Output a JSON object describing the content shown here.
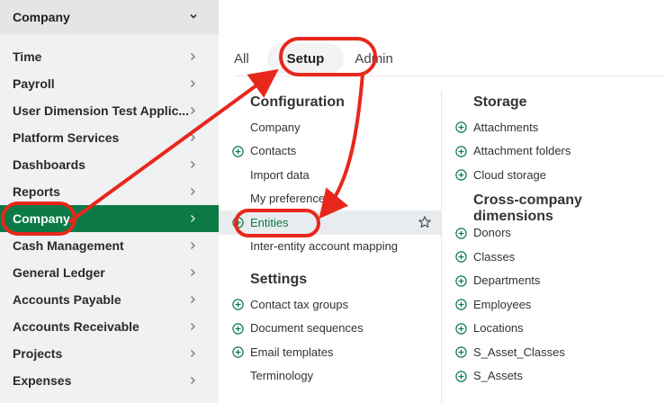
{
  "sidebar": {
    "header_label": "Company",
    "items": [
      {
        "label": "Time"
      },
      {
        "label": "Payroll"
      },
      {
        "label": "User Dimension Test Applic..."
      },
      {
        "label": "Platform Services"
      },
      {
        "label": "Dashboards"
      },
      {
        "label": "Reports"
      },
      {
        "label": "Company",
        "active": true
      },
      {
        "label": "Cash Management"
      },
      {
        "label": "General Ledger"
      },
      {
        "label": "Accounts Payable"
      },
      {
        "label": "Accounts Receivable"
      },
      {
        "label": "Projects"
      },
      {
        "label": "Expenses"
      }
    ]
  },
  "tabs": [
    {
      "label": "All"
    },
    {
      "label": "Setup",
      "active": true
    },
    {
      "label": "Admin"
    }
  ],
  "configuration": {
    "title": "Configuration",
    "items": [
      {
        "label": "Company",
        "plus": false
      },
      {
        "label": "Contacts",
        "plus": true
      },
      {
        "label": "Import data",
        "plus": false
      },
      {
        "label": "My preferences",
        "plus": false
      },
      {
        "label": "Entities",
        "plus": true,
        "highlight": true
      },
      {
        "label": "Inter-entity account mapping",
        "plus": false
      }
    ]
  },
  "settings": {
    "title": "Settings",
    "items": [
      {
        "label": "Contact tax groups",
        "plus": true
      },
      {
        "label": "Document sequences",
        "plus": true
      },
      {
        "label": "Email templates",
        "plus": true
      },
      {
        "label": "Terminology",
        "plus": false
      }
    ]
  },
  "storage": {
    "title": "Storage",
    "items": [
      {
        "label": "Attachments",
        "plus": true
      },
      {
        "label": "Attachment folders",
        "plus": true
      },
      {
        "label": "Cloud storage",
        "plus": true
      }
    ]
  },
  "cross_company": {
    "title": "Cross-company dimensions",
    "items": [
      {
        "label": "Donors",
        "plus": true
      },
      {
        "label": "Classes",
        "plus": true
      },
      {
        "label": "Departments",
        "plus": true
      },
      {
        "label": "Employees",
        "plus": true
      },
      {
        "label": "Locations",
        "plus": true
      },
      {
        "label": "S_Asset_Classes",
        "plus": true
      },
      {
        "label": "S_Assets",
        "plus": true
      }
    ]
  },
  "colors": {
    "brand_green": "#0b7a47",
    "annotation_red": "#e8271c"
  }
}
